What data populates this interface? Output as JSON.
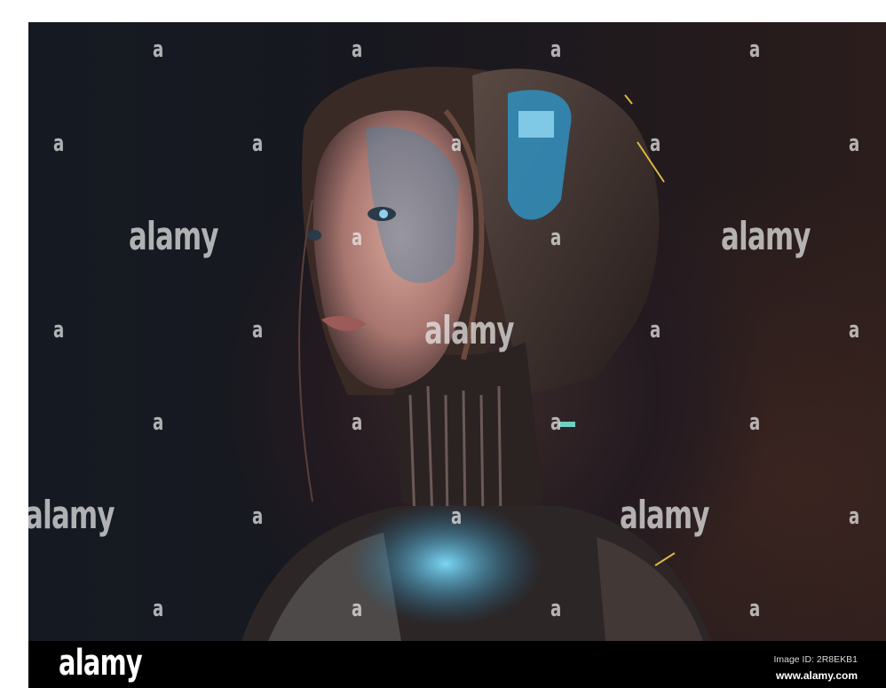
{
  "photo": {
    "subject": "cyborg-woman-portrait",
    "palette": {
      "background": "#17181f",
      "skin": "#c7938a",
      "circuit_blue": "#3fb4e6",
      "accent_gold": "#e0b640"
    }
  },
  "watermark": {
    "mark": "a",
    "word": "alamy"
  },
  "footer": {
    "logo": "alamy",
    "image_id": "Image ID: 2R8EKB1",
    "url": "www.alamy.com"
  }
}
